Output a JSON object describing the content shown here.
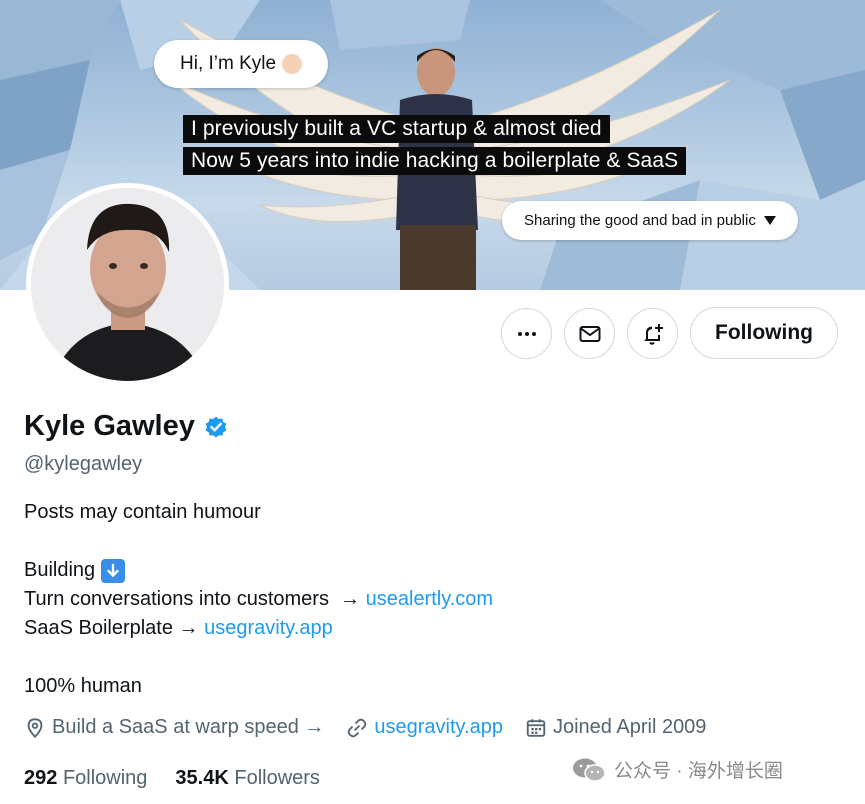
{
  "banner": {
    "greeting": "Hi, I’m Kyle",
    "caption_line1": "I previously built a VC startup & almost died",
    "caption_line2": "Now 5 years into indie hacking a boilerplate & SaaS",
    "pill_text": "Sharing the good and bad in public"
  },
  "actions": {
    "more_icon": "more-horizontal-icon",
    "message_icon": "envelope-icon",
    "notify_icon": "bell-plus-icon",
    "follow_label": "Following"
  },
  "profile": {
    "name": "Kyle Gawley",
    "verified_icon": "verified-badge-icon",
    "handle": "@kylegawley",
    "bio": {
      "line1": "Posts may contain humour",
      "building_label": "Building",
      "building_icon": "down-arrow-emoji-icon",
      "line3_prefix": "Turn conversations into customers  →",
      "line3_link": "usealertly.com",
      "line4_prefix": "SaaS Boilerplate →",
      "line4_link": "usegravity.app",
      "line5": "100% human"
    },
    "meta": {
      "location_icon": "location-pin-icon",
      "location": "Build a SaaS at warp speed →",
      "link_icon": "link-icon",
      "website": "usegravity.app",
      "calendar_icon": "calendar-icon",
      "joined": "Joined April 2009"
    },
    "stats": {
      "following_count": "292",
      "following_label": "Following",
      "followers_count": "35.4K",
      "followers_label": "Followers"
    }
  },
  "watermark": {
    "icon": "wechat-icon",
    "text": "公众号 · 海外增长圈"
  },
  "colors": {
    "link": "#1d9bf0",
    "verified": "#1d9bf0",
    "muted": "#536471",
    "text": "#0f1419"
  }
}
